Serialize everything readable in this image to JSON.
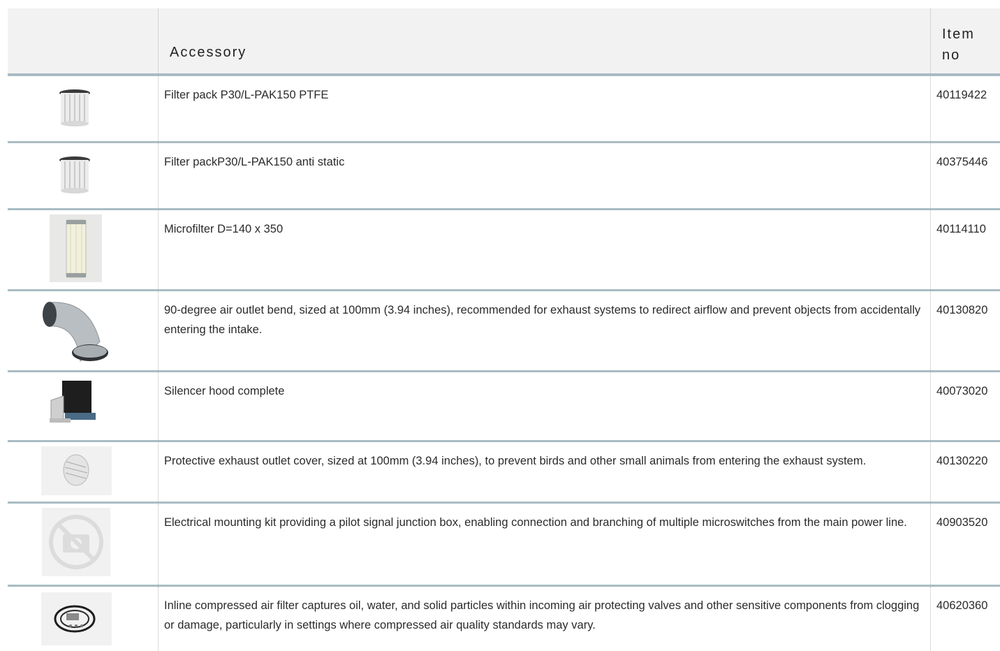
{
  "table": {
    "headers": {
      "image": "",
      "accessory": "Accessory",
      "item_no": "Item no"
    },
    "rows": [
      {
        "desc": "Filter pack P30/L-PAK150 PTFE",
        "item": "40119422",
        "icon": "filter-pack-icon"
      },
      {
        "desc": "Filter packP30/L-PAK150 anti static",
        "item": "40375446",
        "icon": "filter-pack-icon"
      },
      {
        "desc": "Microfilter D=140 x 350",
        "item": "40114110",
        "icon": "microfilter-icon"
      },
      {
        "desc": "90-degree air outlet bend, sized at 100mm (3.94 inches), recommended for exhaust systems to redirect airflow and prevent objects from accidentally entering the intake.",
        "item": "40130820",
        "icon": "outlet-bend-icon"
      },
      {
        "desc": "Silencer hood complete",
        "item": "40073020",
        "icon": "silencer-hood-icon"
      },
      {
        "desc": "Protective exhaust outlet cover, sized at 100mm (3.94 inches), to prevent birds and other small animals from entering the exhaust system.",
        "item": "40130220",
        "icon": "outlet-cover-icon"
      },
      {
        "desc": "Electrical mounting kit providing a pilot signal junction box, enabling connection and branching of multiple microswitches from the main power line.",
        "item": "40903520",
        "icon": "no-image-icon"
      },
      {
        "desc": "Inline compressed air filter captures oil, water, and solid particles within incoming air protecting valves and other sensitive components from clogging or damage, particularly in settings where compressed air quality standards may vary.",
        "item": "40620360",
        "icon": "air-filter-kit-icon"
      }
    ]
  }
}
